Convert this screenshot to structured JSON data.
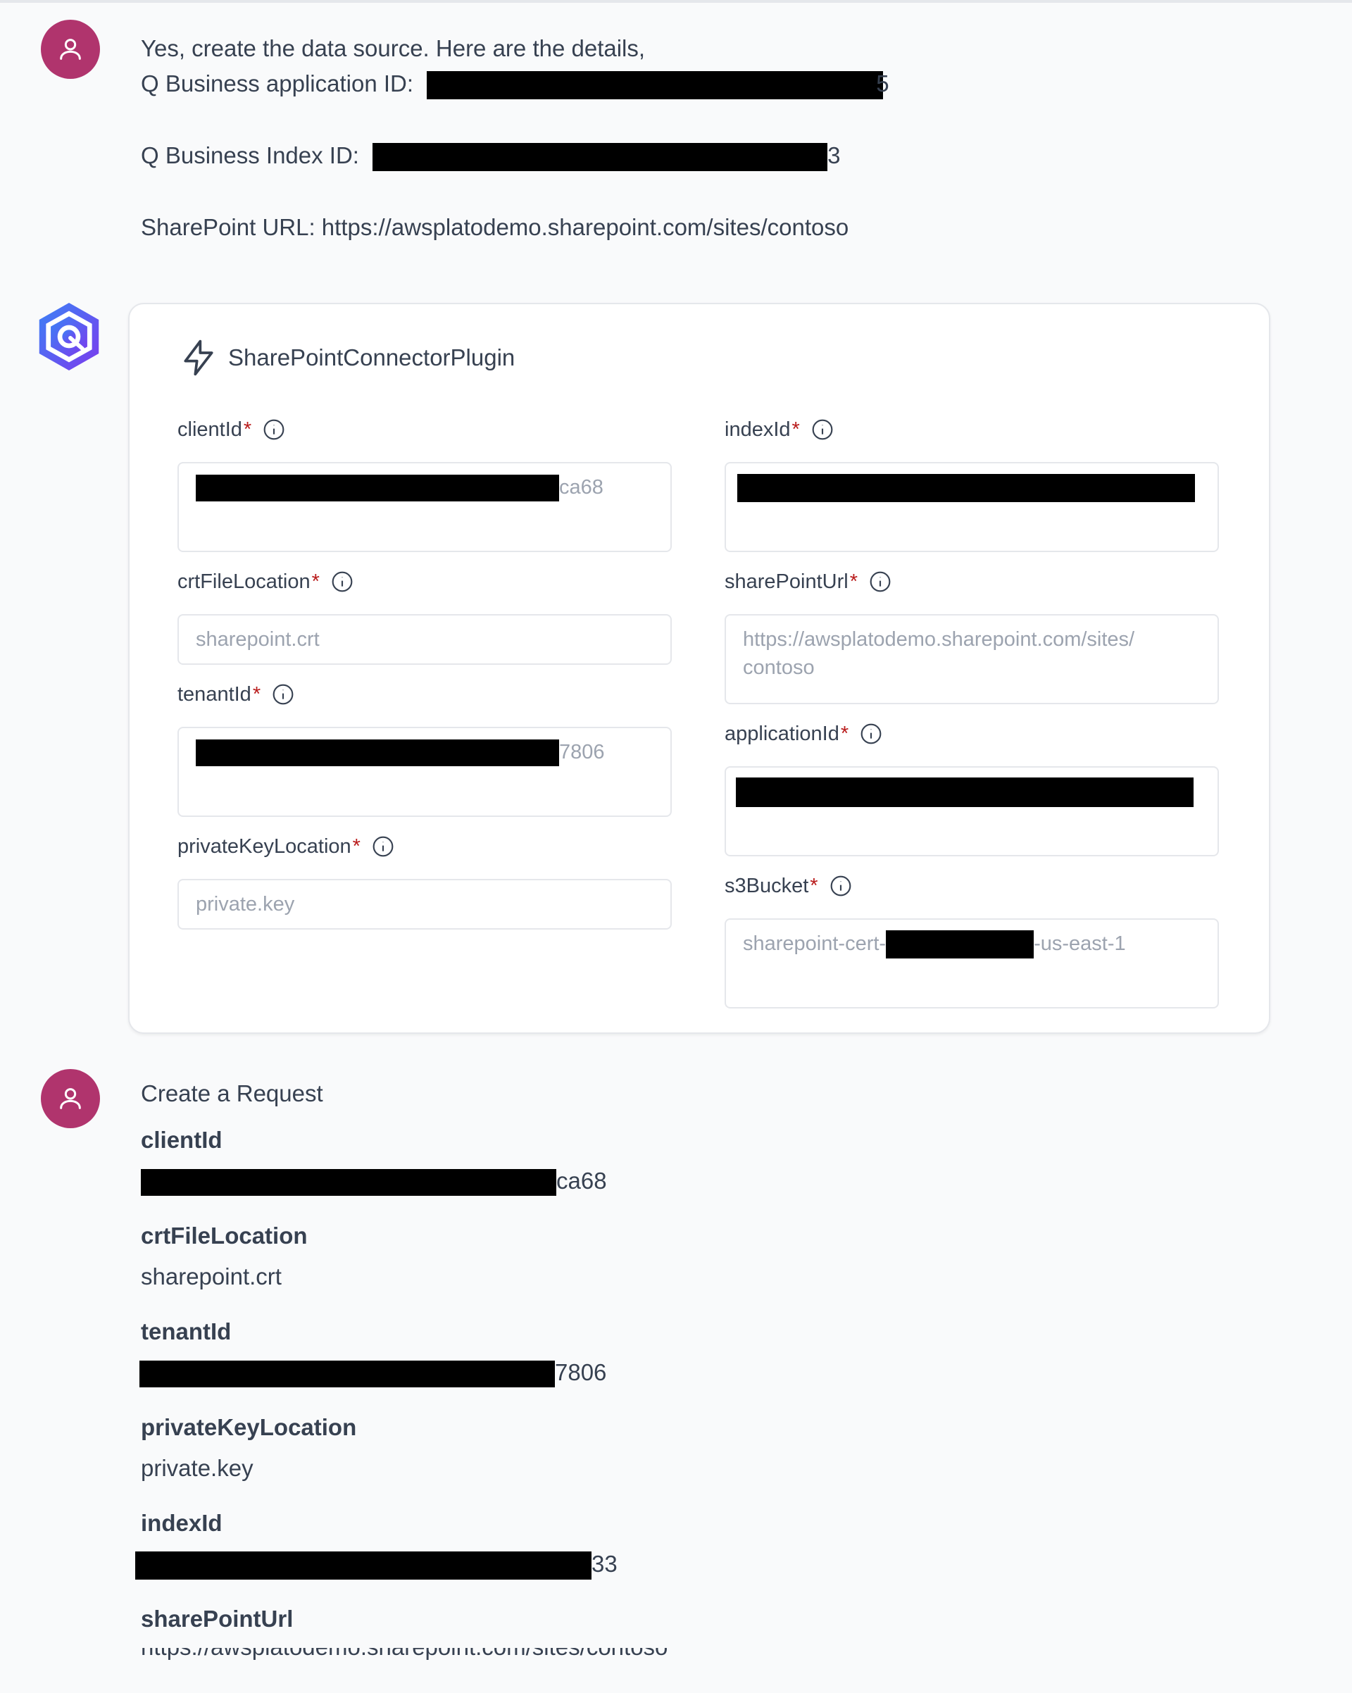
{
  "user_message": {
    "line1": "Yes, create the data source. Here are the details,",
    "app_id_label": "Q Business application ID:",
    "app_id_tail": "5",
    "index_id_label": "Q Business Index ID:",
    "index_id_tail": "3",
    "sharepoint_url_line": "SharePoint URL: https://awsplatodemo.sharepoint.com/sites/contoso"
  },
  "plugin_card": {
    "title": "SharePointConnectorPlugin",
    "fields": {
      "clientId": {
        "label": "clientId",
        "value_tail": "ca68"
      },
      "indexId": {
        "label": "indexId"
      },
      "crtFileLocation": {
        "label": "crtFileLocation",
        "value": "sharepoint.crt"
      },
      "sharePointUrl": {
        "label": "sharePointUrl",
        "value_line1": "https://awsplatodemo.sharepoint.com/sites/",
        "value_line2": "contoso"
      },
      "tenantId": {
        "label": "tenantId",
        "value_tail": "7806"
      },
      "applicationId": {
        "label": "applicationId"
      },
      "privateKeyLocation": {
        "label": "privateKeyLocation",
        "value": "private.key"
      },
      "s3Bucket": {
        "label": "s3Bucket",
        "value_prefix": "sharepoint-cert-",
        "value_suffix": "-us-east-1"
      }
    },
    "required_mark": "*"
  },
  "request_message": {
    "title": "Create a Request",
    "items": [
      {
        "key": "clientId",
        "value_tail": "ca68"
      },
      {
        "key": "crtFileLocation",
        "value": "sharepoint.crt"
      },
      {
        "key": "tenantId",
        "value_tail": "7806"
      },
      {
        "key": "privateKeyLocation",
        "value": "private.key"
      },
      {
        "key": "indexId",
        "value_tail": "33"
      },
      {
        "key": "sharePointUrl",
        "value": "https://awsplatodemo.sharepoint.com/sites/contoso"
      }
    ]
  },
  "colors": {
    "user_avatar": "#b0346d",
    "bot_avatar": "#5b3fd8",
    "required": "#b91c1c",
    "background": "#f9fafb"
  },
  "icons": {
    "user_avatar": "user-icon",
    "bot_avatar": "hexagon-bot-icon",
    "plugin": "lightning-bolt-icon",
    "field_info": "info-icon"
  }
}
